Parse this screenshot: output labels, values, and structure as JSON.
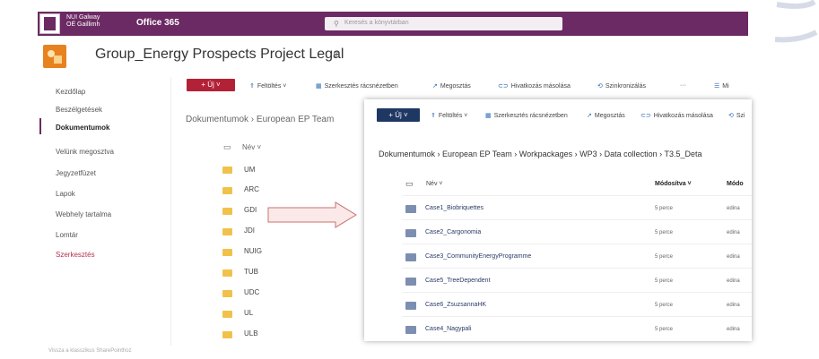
{
  "suite": {
    "org_line1": "NUI Galway",
    "org_line2": "OÉ Gaillimh",
    "app_name": "Office 365",
    "search_placeholder": "Keresés a könyvtárban"
  },
  "site": {
    "title": "Group_Energy Prospects Project Legal"
  },
  "nav": {
    "items": [
      "Kezdőlap",
      "Beszélgetések",
      "Dokumentumok",
      "Velünk megosztva",
      "Jegyzetfüzet",
      "Lapok",
      "Webhely tartalma",
      "Lomtár"
    ],
    "edit": "Szerkesztés",
    "bottom": "Vissza a klasszikus SharePointhoz"
  },
  "commandbar": {
    "new": "+ Új ˅",
    "upload": "Feltöltés ˅",
    "grid": "Szerkesztés rácsnézetben",
    "share": "Megosztás",
    "copylink": "Hivatkozás másolása",
    "sync": "Szinkronizálás",
    "more": "···",
    "right": "Mi"
  },
  "left_list": {
    "breadcrumb": "Dokumentumok  ›  European EP Team",
    "header": "Név ˅",
    "rows": [
      "UM",
      "ARC",
      "GDI",
      "JDI",
      "NUIG",
      "TUB",
      "UDC",
      "UL",
      "ULB"
    ]
  },
  "overlay": {
    "commandbar": {
      "new": "+ Új ˅",
      "upload": "Feltöltés ˅",
      "grid": "Szerkesztés rácsnézetben",
      "share": "Megosztás",
      "copylink": "Hivatkozás másolása",
      "sync": "Szi"
    },
    "breadcrumb": "Dokumentumok  ›  European EP Team  ›  Workpackages  ›  WP3  ›  Data collection  ›  T3.5_Deta",
    "header_name": "Név ˅",
    "header_modified": "Módosítva ˅",
    "header_modified_by": "Módo",
    "rows": [
      {
        "name": "Case1_Biobriquettes",
        "time": "5 perce",
        "user": "edina"
      },
      {
        "name": "Case2_Cargonomia",
        "time": "5 perce",
        "user": "edina"
      },
      {
        "name": "Case3_CommunityEnergyProgramme",
        "time": "5 perce",
        "user": "edina"
      },
      {
        "name": "Case5_TreeDependent",
        "time": "5 perce",
        "user": "edina"
      },
      {
        "name": "Case6_ZsuzsannaHK",
        "time": "5 perce",
        "user": "edina"
      },
      {
        "name": "Case4_Nagypali",
        "time": "5 perce",
        "user": "edina"
      }
    ]
  },
  "colors": {
    "suite_purple": "#6b2a63",
    "new_red": "#b32137",
    "folder_yellow": "#f0c24b",
    "folder_blue": "#7d8fb0"
  }
}
